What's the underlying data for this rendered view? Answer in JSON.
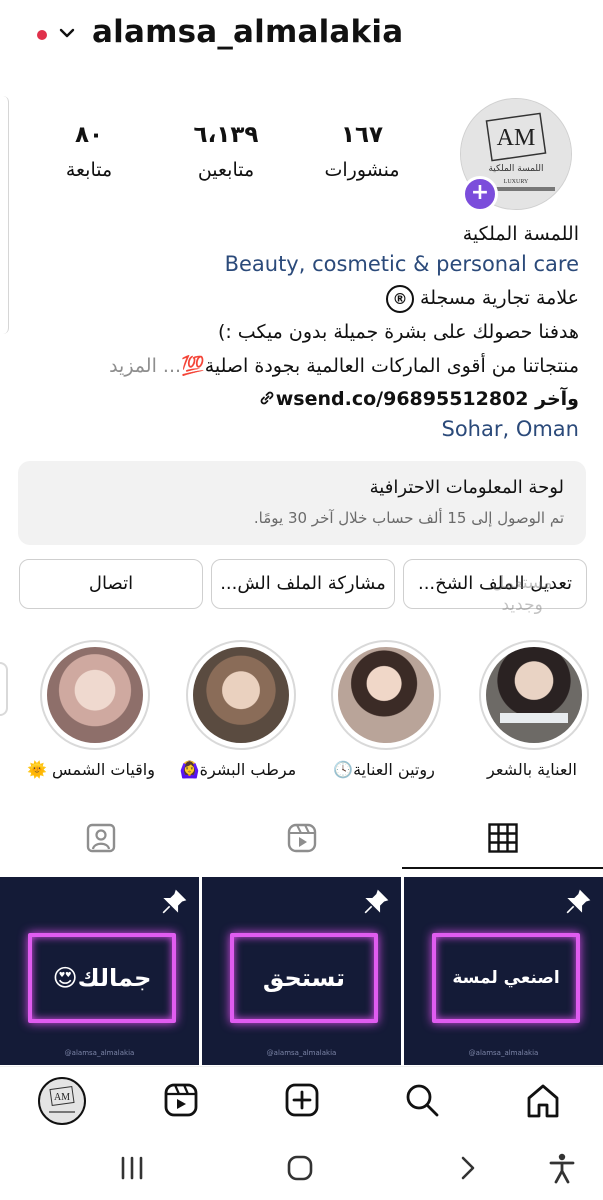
{
  "header": {
    "username": "alamsa_almalakia",
    "status_dot_color": "#e0314b"
  },
  "profile": {
    "avatar_icon": "brand-logo-am",
    "avatar_logo_text": "AM",
    "avatar_caption": "اللمسة الملكية",
    "avatar_caption_en": "LUXURY",
    "add_story_icon": "plus-icon",
    "stats": [
      {
        "num": "١٦٧",
        "label": "منشورات"
      },
      {
        "num": "٦،١٣٩",
        "label": "متابعين"
      },
      {
        "num": "٨٠",
        "label": "متابعة"
      }
    ],
    "name": "اللمسة الملكية",
    "category": "Beauty, cosmetic & personal care",
    "trademark": "علامة تجارية مسجلة",
    "trademark_symbol": "®",
    "bio_line1": "هدفنا حصولك على بشرة  جميلة بدون ميكب :)",
    "bio_line2": "منتجاتنا  من أقوى الماركات العالمية بجودة اصلية",
    "bio_emoji": "💯",
    "more_label": "... المزيد",
    "link_text": "wsend.co/96895512802",
    "link_suffix": "وآخر",
    "link_icon": "link-icon",
    "location": "Sohar, Oman"
  },
  "dashboard": {
    "title": "لوحة المعلومات الاحترافية",
    "subtitle": "تم الوصول إلى 15 ألف حساب خلال آخر 30 يومًا."
  },
  "buttons": {
    "edit": "تعديل الملف الشخ...",
    "share": "مشاركة الملف الش...",
    "contact": "اتصال"
  },
  "watermark": "مستعمل\nوجديد",
  "highlights": [
    {
      "label": "العناية بالشعر"
    },
    {
      "label": "روتين العناية",
      "emoji": "🕓"
    },
    {
      "label": "مرطب البشرة",
      "emoji": "🙆‍♀️"
    },
    {
      "label": "واقيات الشمس",
      "emoji": "🌞"
    }
  ],
  "tabs": [
    {
      "name": "grid",
      "icon": "grid-icon"
    },
    {
      "name": "reels",
      "icon": "reels-icon"
    },
    {
      "name": "tagged",
      "icon": "tagged-person-icon"
    }
  ],
  "posts": [
    {
      "text": "اصنعي لمسة",
      "handle": "@alamsa_almalakia",
      "pinned": true
    },
    {
      "text": "تستحق",
      "handle": "@alamsa_almalakia",
      "pinned": true
    },
    {
      "text": "جمالك",
      "emoji": "😍",
      "handle": "@alamsa_almalakia",
      "pinned": true
    }
  ],
  "colors": {
    "link_blue": "#2b4a7a",
    "post_bg": "#141b37",
    "neon": "#e05cf0",
    "accent_purple": "#7b4ddb"
  }
}
